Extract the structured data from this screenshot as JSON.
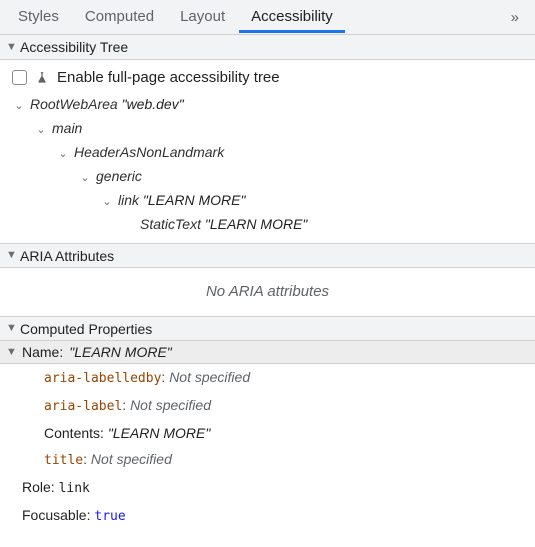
{
  "tabs": {
    "styles": "Styles",
    "computed": "Computed",
    "layout": "Layout",
    "accessibility": "Accessibility",
    "more_glyph": "»"
  },
  "sections": {
    "tree": "Accessibility Tree",
    "aria": "ARIA Attributes",
    "computed": "Computed Properties"
  },
  "enable_row": "Enable full-page accessibility tree",
  "tree": {
    "root_role": "RootWebArea",
    "root_name": "web.dev",
    "main": "main",
    "header": "HeaderAsNonLandmark",
    "generic": "generic",
    "link_role": "link",
    "link_name": "LEARN MORE",
    "static_role": "StaticText",
    "static_name": "LEARN MORE"
  },
  "aria_empty": "No ARIA attributes",
  "cp": {
    "name_label": "Name:",
    "name_value": "LEARN MORE",
    "aria_labelledby": "aria-labelledby",
    "aria_label": "aria-label",
    "contents_label": "Contents:",
    "contents_value": "LEARN MORE",
    "title": "title",
    "not_specified": "Not specified",
    "role_label": "Role:",
    "role_value": "link",
    "focusable_label": "Focusable:",
    "focusable_value": "true"
  }
}
